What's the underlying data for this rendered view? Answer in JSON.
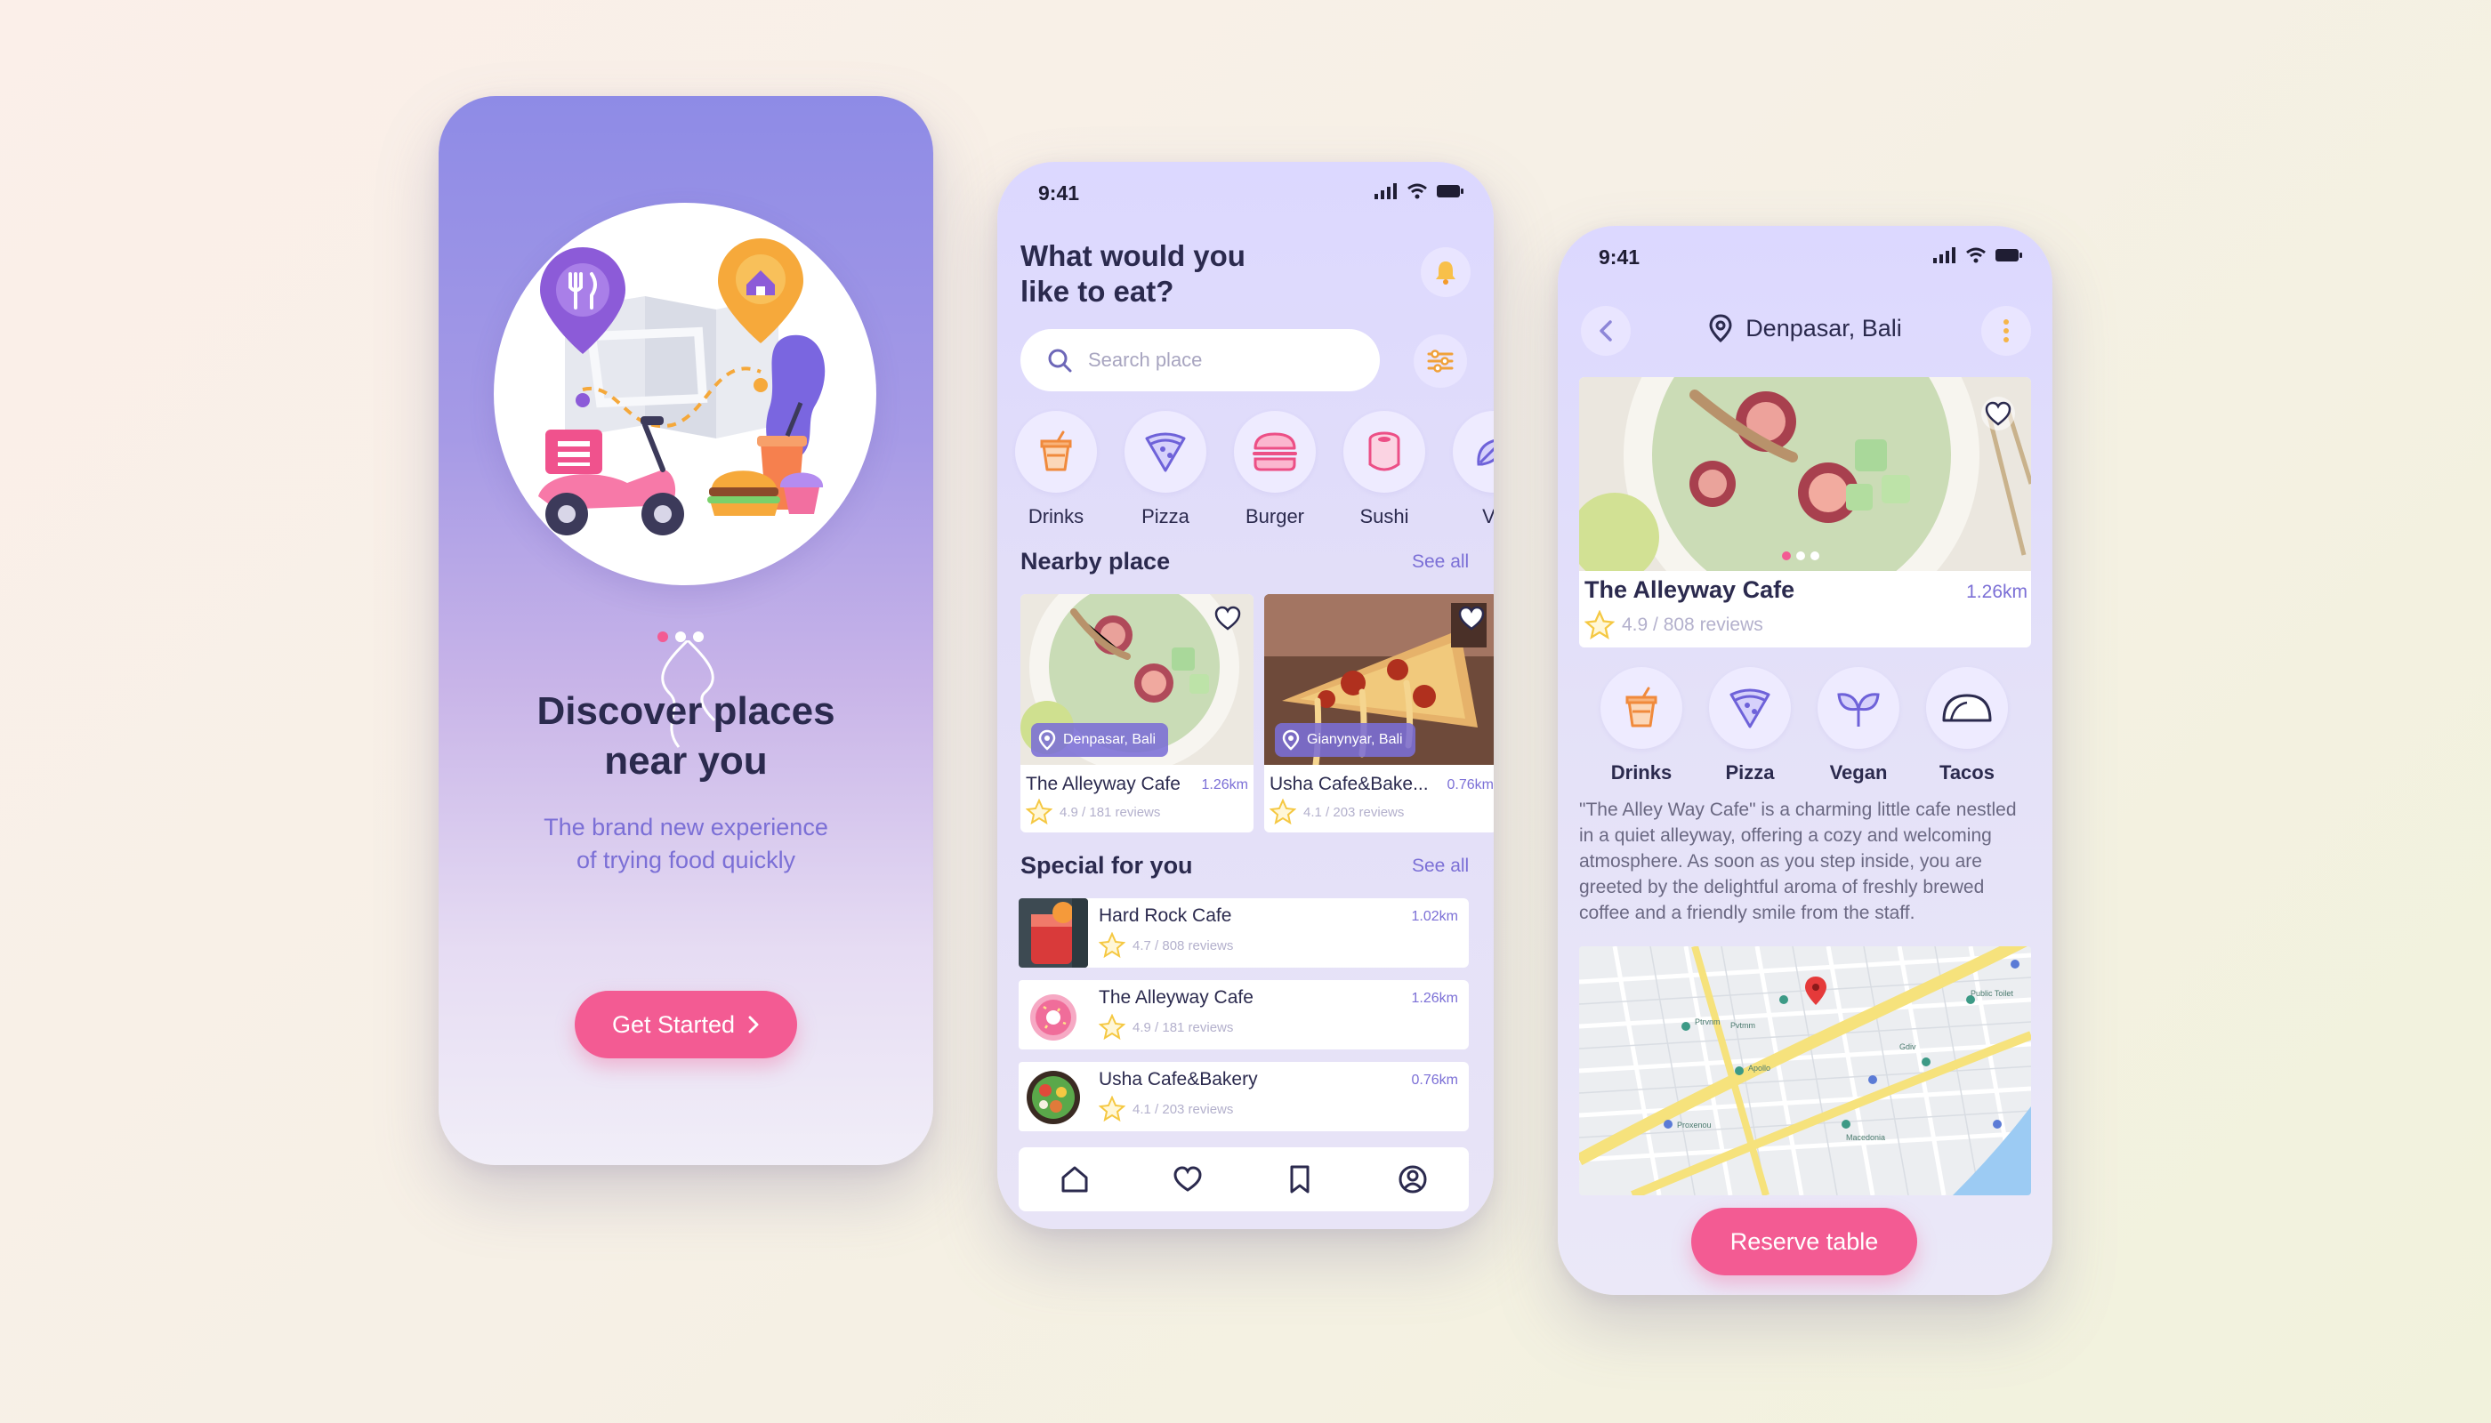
{
  "colors": {
    "accent_pink": "#f35b93",
    "accent_purple": "#7b6fd6",
    "text_dark": "#2b2a4e",
    "card_bg": "#ffffff",
    "star": "#f5c842"
  },
  "onboarding": {
    "title_line1": "Discover places",
    "title_line2": "near you",
    "subtitle_line1": "The brand new experience",
    "subtitle_line2": "of trying food quickly",
    "cta_label": "Get Started",
    "cta_icon": "chevron-right-icon"
  },
  "home": {
    "status_time": "9:41",
    "heading_line1": "What would you",
    "heading_line2": "like to eat?",
    "search_placeholder": "Search place",
    "categories": [
      {
        "label": "Drinks",
        "icon": "drink-icon"
      },
      {
        "label": "Pizza",
        "icon": "pizza-icon"
      },
      {
        "label": "Burger",
        "icon": "burger-icon"
      },
      {
        "label": "Sushi",
        "icon": "sushi-icon"
      },
      {
        "label": "Ve",
        "icon": "vegan-icon"
      }
    ],
    "nearby_title": "Nearby place",
    "see_all": "See all",
    "nearby": [
      {
        "location": "Denpasar, Bali",
        "name": "The Alleyway Cafe",
        "distance": "1.26km",
        "rating": "4.9 / 181 reviews"
      },
      {
        "location": "Gianynyar, Bali",
        "name": "Usha Cafe&Bake...",
        "distance": "0.76km",
        "rating": "4.1 / 203 reviews"
      }
    ],
    "special_title": "Special for you",
    "special": [
      {
        "name": "Hard Rock Cafe",
        "distance": "1.02km",
        "rating": "4.7 / 808 reviews"
      },
      {
        "name": "The Alleyway Cafe",
        "distance": "1.26km",
        "rating": "4.9 / 181 reviews"
      },
      {
        "name": "Usha Cafe&Bakery",
        "distance": "0.76km",
        "rating": "4.1 / 203 reviews"
      }
    ],
    "nav": [
      "home-icon",
      "heart-icon",
      "bookmark-icon",
      "profile-icon"
    ]
  },
  "detail": {
    "status_time": "9:41",
    "location": "Denpasar, Bali",
    "name": "The Alleyway Cafe",
    "distance": "1.26km",
    "rating": "4.9 / 808 reviews",
    "categories": [
      {
        "label": "Drinks",
        "icon": "drink-icon"
      },
      {
        "label": "Pizza",
        "icon": "pizza-icon"
      },
      {
        "label": "Vegan",
        "icon": "vegan-icon"
      },
      {
        "label": "Tacos",
        "icon": "tacos-icon"
      }
    ],
    "description": "\"The Alley Way Cafe\" is a charming little cafe nestled in a quiet alleyway, offering a cozy and welcoming atmosphere. As soon as you step inside, you are greeted by the delightful aroma of freshly brewed coffee and a friendly smile from the staff.",
    "map_labels": [
      "Pvtmm",
      "Gdiv",
      "Apollo",
      "Ptrvnm",
      "Macedonia",
      "Proxenou",
      "Public Toilet"
    ],
    "reserve_label": "Reserve table"
  }
}
